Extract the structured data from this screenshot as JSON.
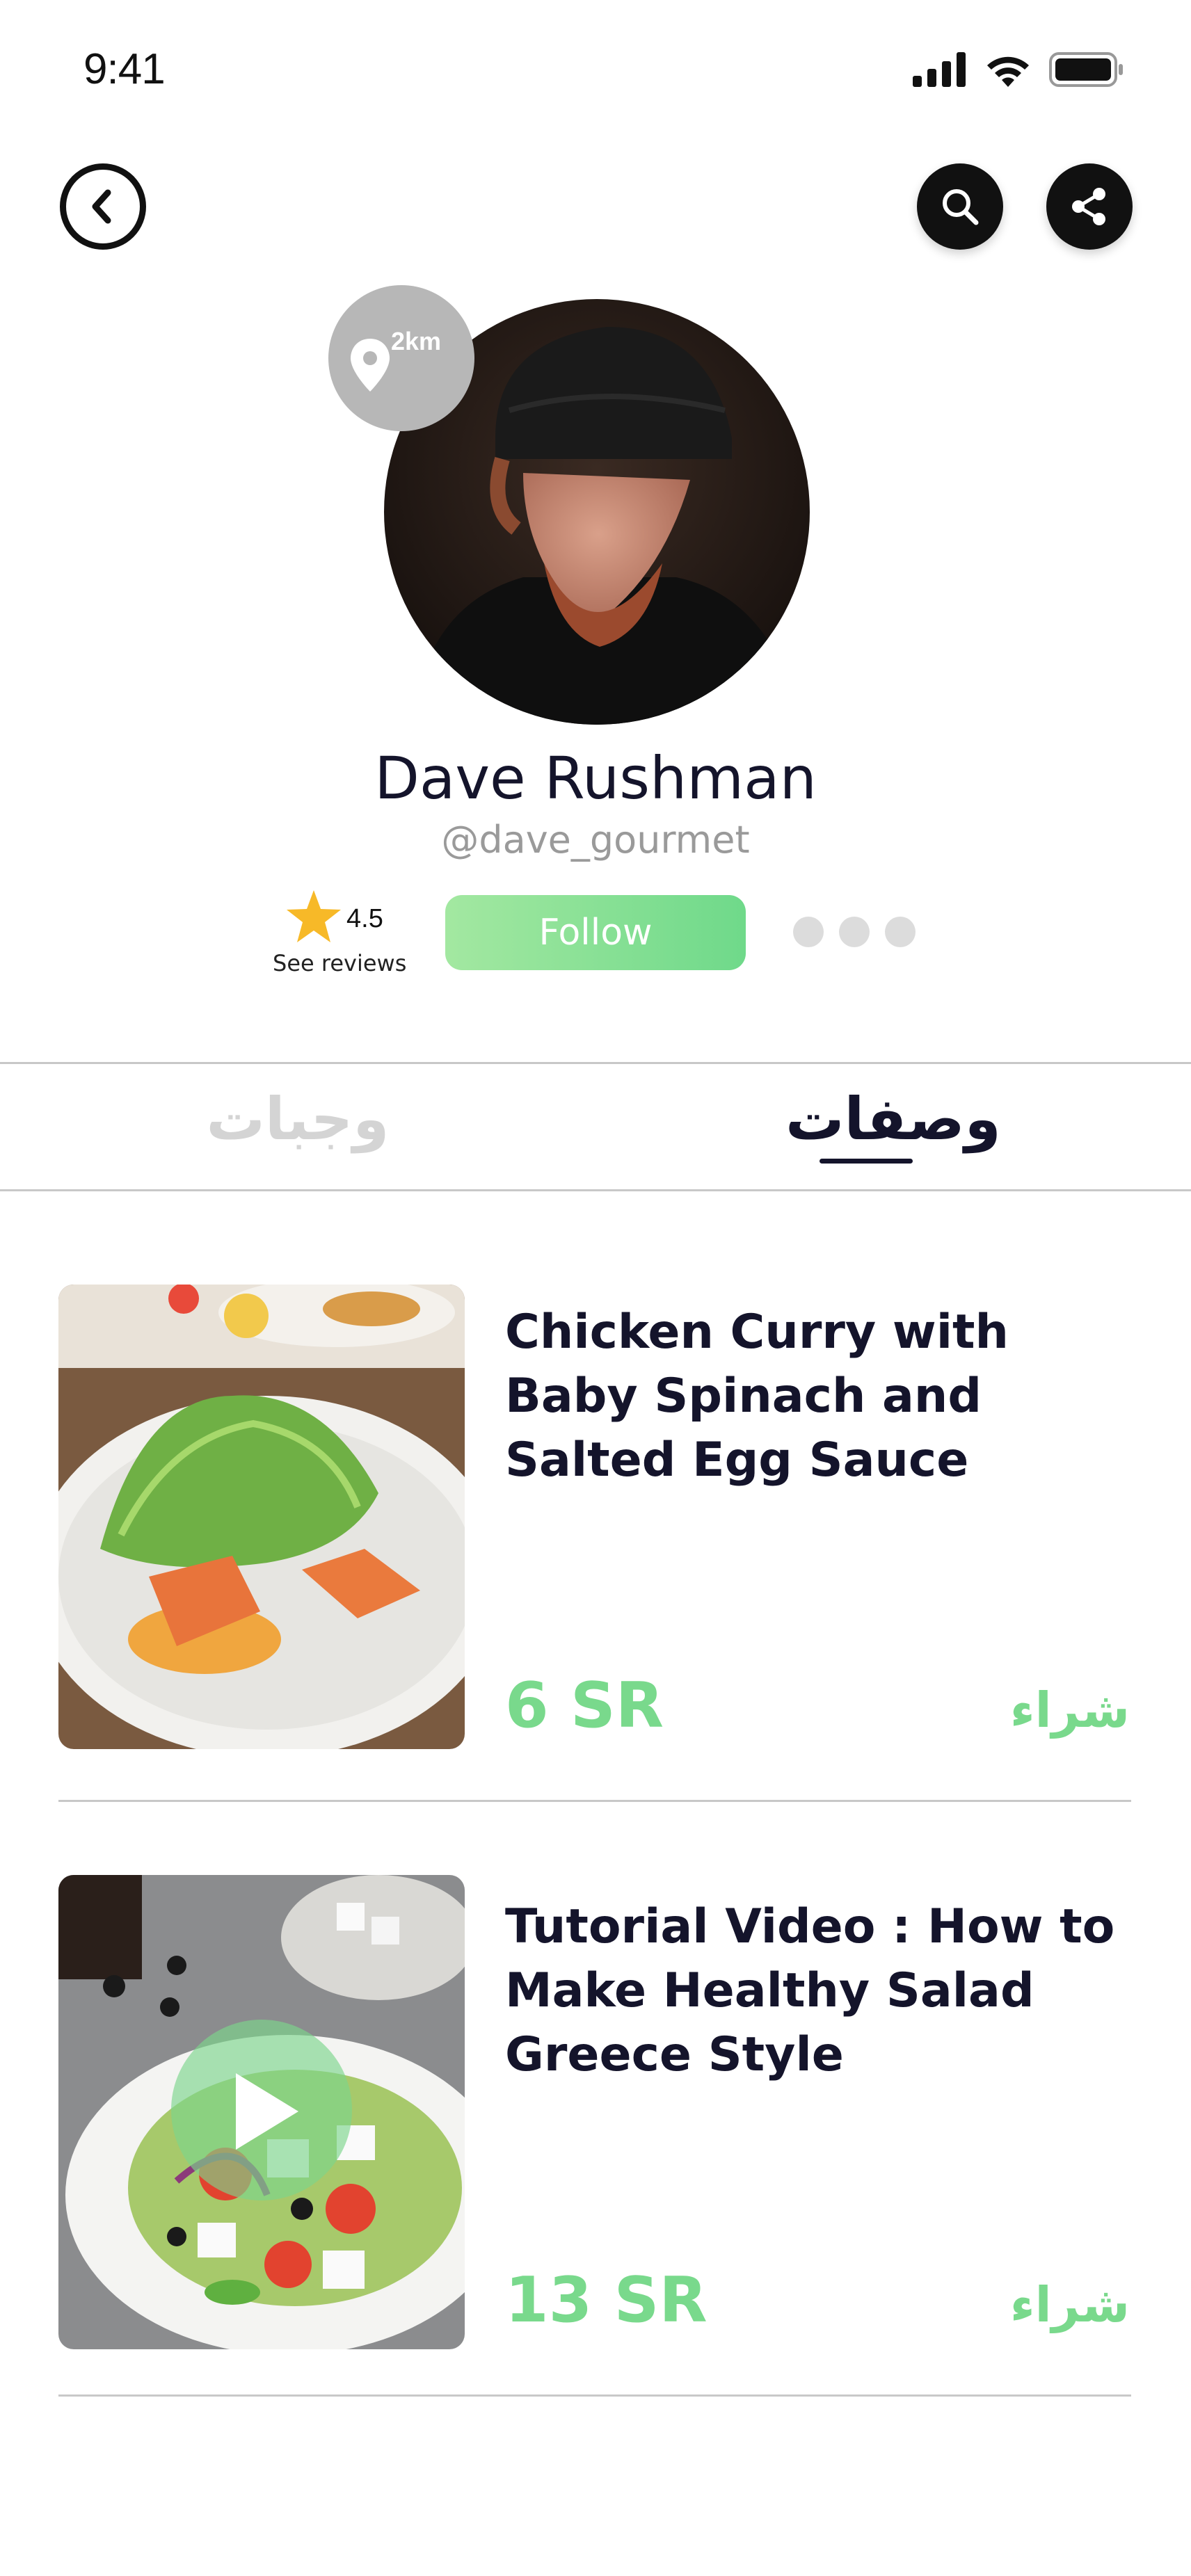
{
  "status_bar": {
    "time": "9:41"
  },
  "header": {
    "back_icon": "chevron-left-icon",
    "search_icon": "search-icon",
    "share_icon": "share-icon"
  },
  "profile": {
    "distance": "2km",
    "name": "Dave Rushman",
    "handle": "@dave_gourmet",
    "rating": "4.5",
    "see_reviews": "See reviews",
    "follow_label": "Follow"
  },
  "tabs": [
    {
      "label": "وجبات",
      "active": false
    },
    {
      "label": "وصفات",
      "active": true
    }
  ],
  "items": [
    {
      "title": "Chicken Curry with Baby Spinach and Salted Egg Sauce",
      "price": "6 SR",
      "buy_label": "شراء",
      "has_video": false
    },
    {
      "title": "Tutorial Video : How to Make Healthy Salad Greece Style",
      "price": "13 SR",
      "buy_label": "شراء",
      "has_video": true
    }
  ],
  "colors": {
    "accent_green": "#79d98c",
    "text_dark": "#14142b",
    "muted": "#9a9a9a"
  }
}
